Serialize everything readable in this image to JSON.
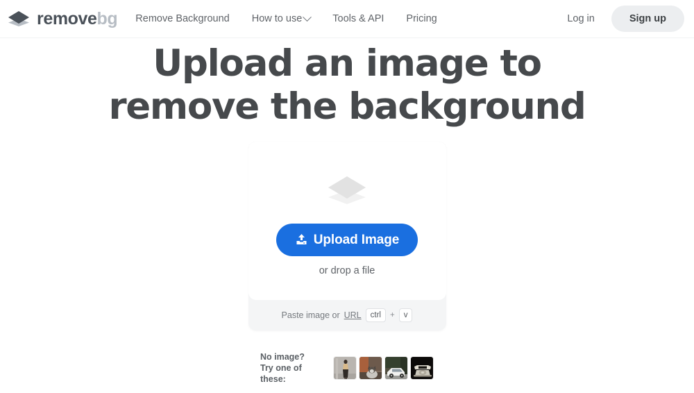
{
  "header": {
    "logo": {
      "icon": "layers-logo-icon",
      "word1": "remove",
      "word2": "bg"
    },
    "nav": [
      {
        "label": "Remove Background",
        "has_chevron": false
      },
      {
        "label": "How to use",
        "has_chevron": true
      },
      {
        "label": "Tools & API",
        "has_chevron": false
      },
      {
        "label": "Pricing",
        "has_chevron": false
      }
    ],
    "login_label": "Log in",
    "signup_label": "Sign up"
  },
  "hero": {
    "line1": "Upload an image to",
    "line2": "remove the background"
  },
  "upload_card": {
    "placeholder_icon": "layers-placeholder-icon",
    "button_icon": "upload-tray-icon",
    "button_label": "Upload Image",
    "drop_text": "or drop a file",
    "paste_text": "Paste image or",
    "url_label": "URL",
    "key_ctrl": "ctrl",
    "key_plus": "+",
    "key_v": "v"
  },
  "samples": {
    "label_line1": "No image?",
    "label_line2": "Try one of these:",
    "thumbnails": [
      {
        "name": "sample-woman-standing"
      },
      {
        "name": "sample-cat"
      },
      {
        "name": "sample-white-car"
      },
      {
        "name": "sample-rotary-telephone"
      }
    ]
  },
  "colors": {
    "accent_blue": "#1a6fe0",
    "heading_gray": "#46494c",
    "logo_dark": "#4a5159",
    "logo_light": "#b7bdc4",
    "card_panel": "#f4f5f6",
    "signup_bg": "#eceef0"
  }
}
